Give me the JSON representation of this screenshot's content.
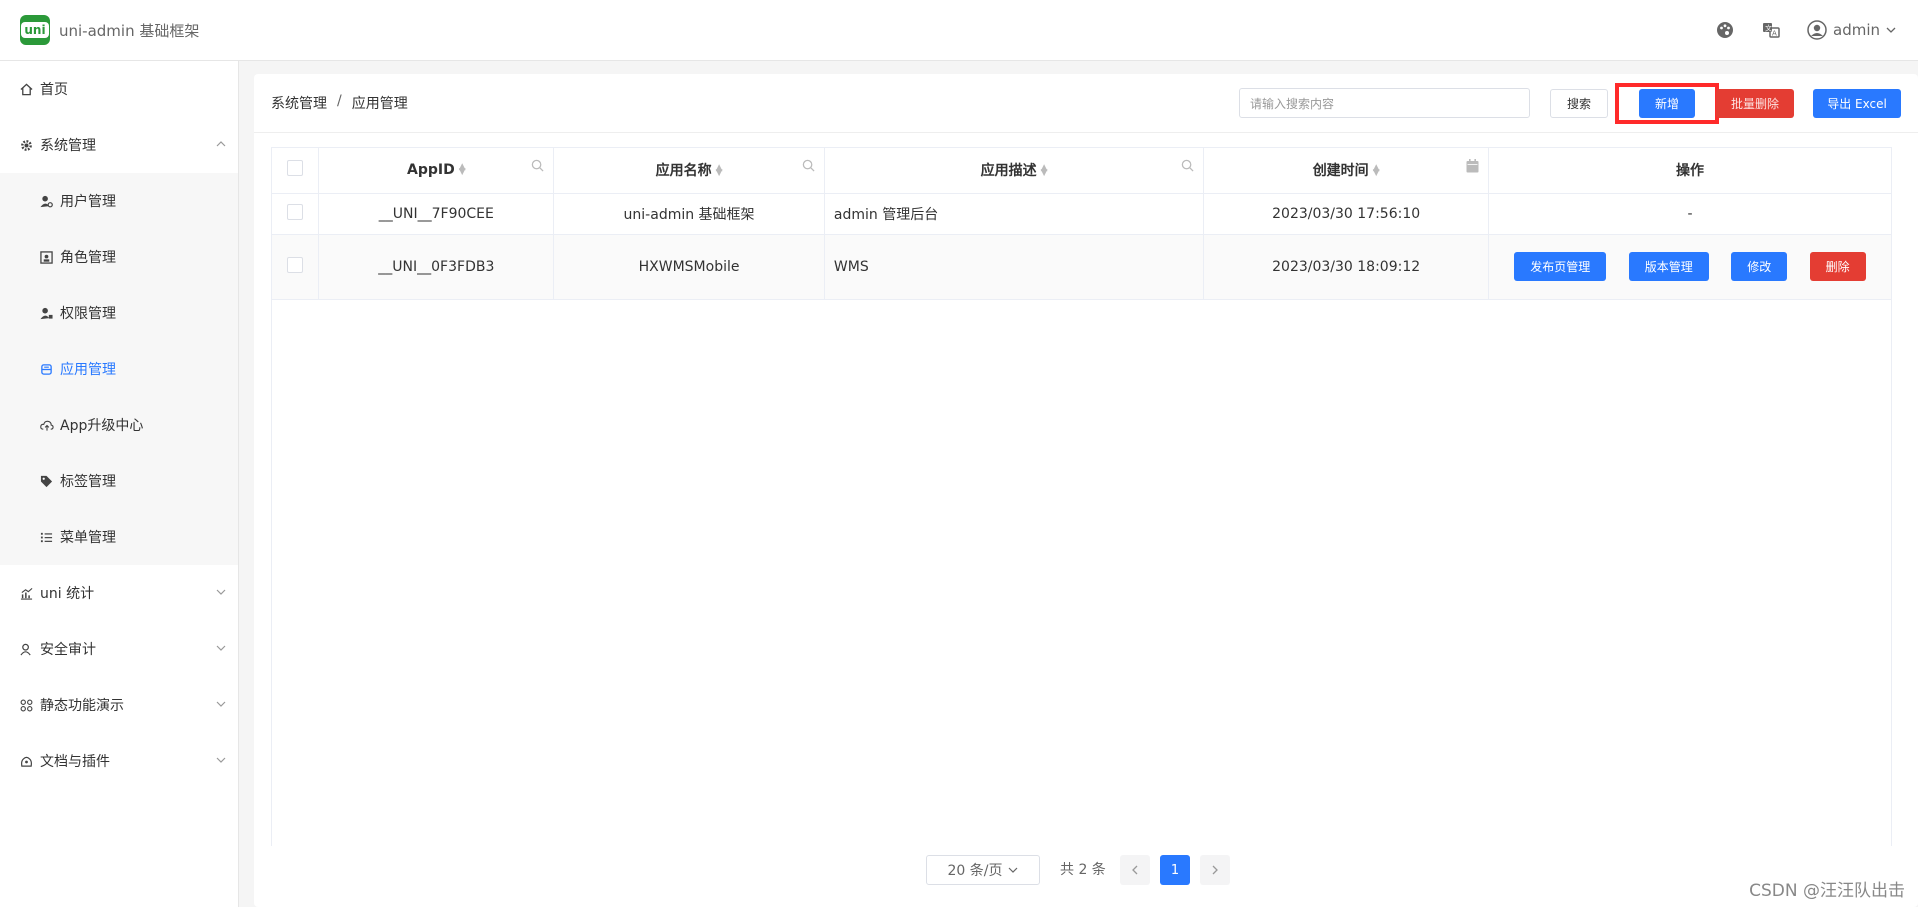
{
  "header": {
    "app_title": "uni-admin 基础框架",
    "logo_text": "uni",
    "user_name": "admin"
  },
  "sidebar": {
    "items": [
      {
        "label": "首页",
        "icon": "home-icon"
      },
      {
        "label": "系统管理",
        "icon": "gear-icon",
        "expanded": true
      },
      {
        "label": "uni 统计",
        "icon": "chart-icon"
      },
      {
        "label": "安全审计",
        "icon": "user-audit-icon"
      },
      {
        "label": "静态功能演示",
        "icon": "grid-icon"
      },
      {
        "label": "文档与插件",
        "icon": "plugin-icon"
      }
    ],
    "sub_items": [
      {
        "label": "用户管理",
        "icon": "user-gear-icon"
      },
      {
        "label": "角色管理",
        "icon": "role-icon"
      },
      {
        "label": "权限管理",
        "icon": "permission-icon"
      },
      {
        "label": "应用管理",
        "icon": "app-icon",
        "active": true
      },
      {
        "label": "App升级中心",
        "icon": "cloud-upload-icon"
      },
      {
        "label": "标签管理",
        "icon": "tag-icon"
      },
      {
        "label": "菜单管理",
        "icon": "list-icon"
      }
    ]
  },
  "breadcrumb": {
    "parent": "系统管理",
    "separator": "/",
    "current": "应用管理"
  },
  "toolbar": {
    "search_placeholder": "请输入搜索内容",
    "search_label": "搜索",
    "add_label": "新增",
    "batch_delete_label": "批量删除",
    "export_label": "导出 Excel"
  },
  "table": {
    "columns": [
      "AppID",
      "应用名称",
      "应用描述",
      "创建时间",
      "操作"
    ],
    "rows": [
      {
        "appid": "__UNI__7F90CEE",
        "name": "uni-admin 基础框架",
        "desc": "admin 管理后台",
        "created": "2023/03/30 17:56:10",
        "ops": "-"
      },
      {
        "appid": "__UNI__0F3FDB3",
        "name": "HXWMSMobile",
        "desc": "WMS",
        "created": "2023/03/30 18:09:12"
      }
    ],
    "row_actions": {
      "publish": "发布页管理",
      "version": "版本管理",
      "edit": "修改",
      "delete": "删除"
    }
  },
  "pagination": {
    "page_size": "20 条/页",
    "total": "共 2 条",
    "current_page": "1"
  },
  "watermark": "CSDN @汪汪队出击",
  "colors": {
    "primary": "#2979ff",
    "danger": "#e43d33",
    "highlight": "#ff2a2a",
    "logo": "#2b9939"
  }
}
